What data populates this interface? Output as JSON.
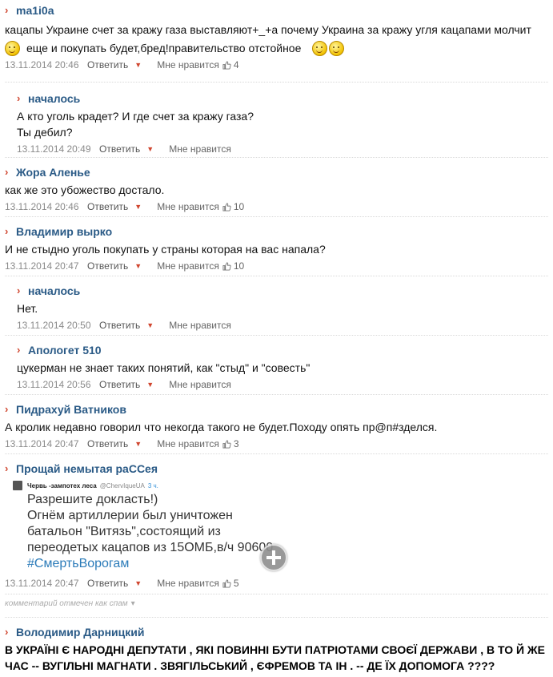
{
  "comments": [
    {
      "author": "ma1i0a",
      "text1": "кацапы Украине счет за кражу газа выставляют+_+а почему Украина за кражу угля кацапами молчит",
      "text2": "еще и покупать будет,бред!правительство отстойное",
      "date": "13.11.2014 20:46",
      "reply": "Ответить",
      "like": "Мне нравится",
      "count": "4"
    },
    {
      "author": "началось",
      "text1": "А кто уголь крадет? И где счет за кражу газа?",
      "text2": "Ты дебил?",
      "date": "13.11.2014 20:49",
      "reply": "Ответить",
      "like": "Мне нравится",
      "count": ""
    },
    {
      "author": "Жора Аленье",
      "text1": "как же это убожество достало.",
      "date": "13.11.2014 20:46",
      "reply": "Ответить",
      "like": "Мне нравится",
      "count": "10"
    },
    {
      "author": "Владимир вырко",
      "text1": "И не стыдно уголь покупать у страны которая на вас напала?",
      "date": "13.11.2014 20:47",
      "reply": "Ответить",
      "like": "Мне нравится",
      "count": "10"
    },
    {
      "author": "началось",
      "text1": "Нет.",
      "date": "13.11.2014 20:50",
      "reply": "Ответить",
      "like": "Мне нравится",
      "count": ""
    },
    {
      "author": "Апологет 510",
      "text1": "цукерман не знает таких понятий, как \"стыд\" и \"совесть\"",
      "date": "13.11.2014 20:56",
      "reply": "Ответить",
      "like": "Мне нравится",
      "count": ""
    },
    {
      "author": "Пидрахуй Ватников",
      "text1": "А кролик недавно говорил что некогда такого не будет.Походу опять пр@п#зделся.",
      "date": "13.11.2014 20:47",
      "reply": "Ответить",
      "like": "Мне нравится",
      "count": "3"
    },
    {
      "author": "Прощай немытая раССея",
      "date": "13.11.2014 20:47",
      "reply": "Ответить",
      "like": "Мне нравится",
      "count": "5"
    },
    {
      "author": "Володимир Дарницкий",
      "text1": "В УКРАЇНІ Є НАРОДНІ ДЕПУТАТИ , ЯКІ ПОВИННІ БУТИ ПАТРІОТАМИ СВОЄЇ ДЕРЖАВИ , В ТО Й ЖЕ",
      "text2": "ЧАС -- ВУГІЛЬНІ МАГНАТИ . ЗВЯГІЛЬСЬКИЙ , ЄФРЕМОВ ТА ІН . -- ДЕ ЇХ ДОПОМОГА ????"
    }
  ],
  "tweet": {
    "name": "Червь -зампотех леса",
    "handle": "@ChervIqueUA",
    "time": "3 ч.",
    "line1": "Разрешите докласть!)",
    "line2": "Огнём артиллерии был уничтожен",
    "line3": "батальон \"Витязь\",состоящий из",
    "line4": "переодетых кацапов из 15ОМБ,в/ч 90600",
    "hashtag": "#СмертьВорогам"
  },
  "spam_note": "комментарий отмечен как спам",
  "colors": {
    "author": "#2a5a86",
    "accent": "#d0462f",
    "meta": "#8a8a8a",
    "hashtag": "#2b7bb9"
  }
}
